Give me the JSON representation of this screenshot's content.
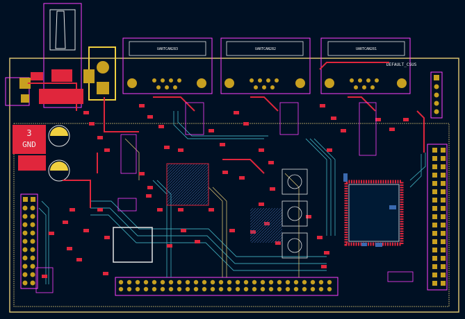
{
  "board": {
    "colors": {
      "background": "#001023",
      "edge": "#d8c070",
      "front_copper": "#e0263c",
      "back_copper": "#3aa0b0",
      "pad": "#c8a020",
      "courtyard": "#ff40ff",
      "silkscreen": "#f0f0f0",
      "zone_fill": "#2a4a78"
    },
    "connectors": [
      {
        "id": "uart0",
        "label": "UARTCAN283",
        "pins": 4
      },
      {
        "id": "uart1",
        "label": "UARTCAN282",
        "pins": 4
      },
      {
        "id": "uart2",
        "label": "UARTCAN281",
        "pins": 4
      }
    ],
    "power_label_number": "3",
    "power_label_net": "GND",
    "top_right_text": "DEFAULT_CSUS"
  }
}
